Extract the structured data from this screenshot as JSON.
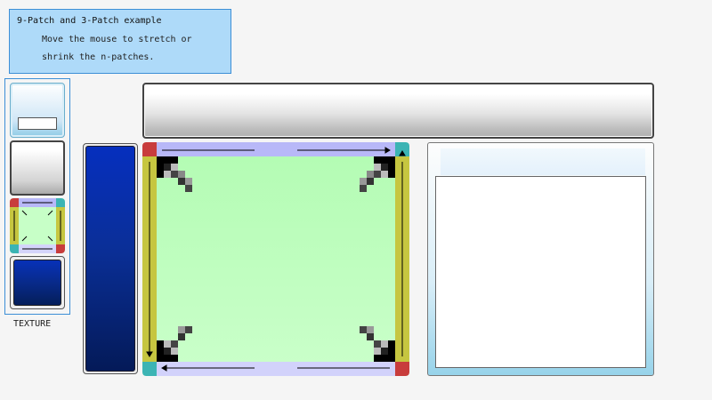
{
  "info": {
    "title": "9-Patch and 3-Patch example",
    "line1": "Move the mouse to stretch or",
    "line2": "shrink the n-patches."
  },
  "texture": {
    "label": "TEXTURE"
  },
  "colors": {
    "info_bg": "#aedaf9",
    "info_border": "#3d8fd6",
    "ninepatch_fill": "#c7ffc7",
    "ninepatch_edge_h": "#b8b8f8",
    "ninepatch_edge_v": "#c6c640",
    "corner_red": "#c83c3c",
    "corner_teal": "#3cb4b4",
    "blue_gradient_top": "#062fbe",
    "blue_gradient_bottom": "#041a58"
  },
  "icons": [
    "corner-marker-icon",
    "stretch-arrow-icon"
  ]
}
